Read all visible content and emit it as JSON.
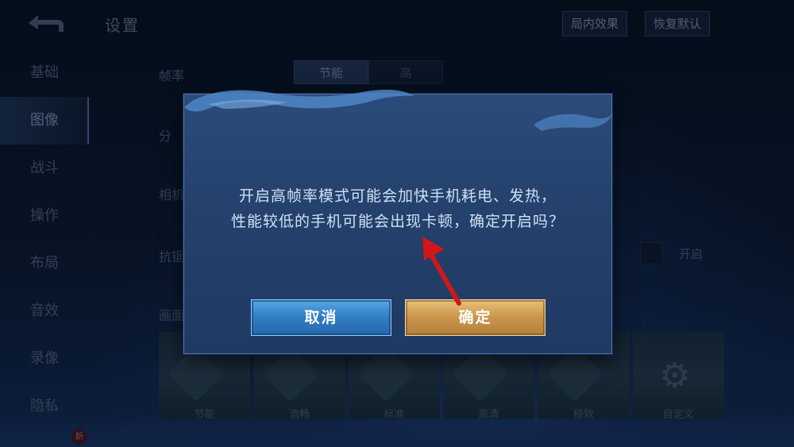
{
  "header": {
    "title": "设置",
    "btn_in_game_effect": "局内效果",
    "btn_restore_default": "恢复默认"
  },
  "sidebar": {
    "items": [
      {
        "label": "基础"
      },
      {
        "label": "图像",
        "active": true
      },
      {
        "label": "战斗"
      },
      {
        "label": "操作"
      },
      {
        "label": "布局"
      },
      {
        "label": "音效"
      },
      {
        "label": "录像"
      },
      {
        "label": "隐私"
      }
    ]
  },
  "settings": {
    "frame_rate_label": "帧率",
    "frame_rate_options": [
      "节能",
      "高"
    ],
    "frame_rate_selected": "节能",
    "row2_label": "分",
    "camera_label": "相机",
    "antialias_label": "抗锯",
    "antialias_toggle_label": "开启",
    "quality_label": "画面",
    "presets": [
      {
        "label": "节能"
      },
      {
        "label": "流畅"
      },
      {
        "label": "标准"
      },
      {
        "label": "高清"
      },
      {
        "label": "极致"
      },
      {
        "label": "自定义"
      }
    ]
  },
  "badge_new": "新",
  "dialog": {
    "message_line1": "开启高帧率模式可能会加快手机耗电、发热，",
    "message_line2": "性能较低的手机可能会出现卡顿，确定开启吗？",
    "cancel_label": "取消",
    "confirm_label": "确定"
  },
  "colors": {
    "cancel_button": "#3b8fd6",
    "confirm_button": "#c9954a",
    "annotation_arrow": "#d01818"
  }
}
